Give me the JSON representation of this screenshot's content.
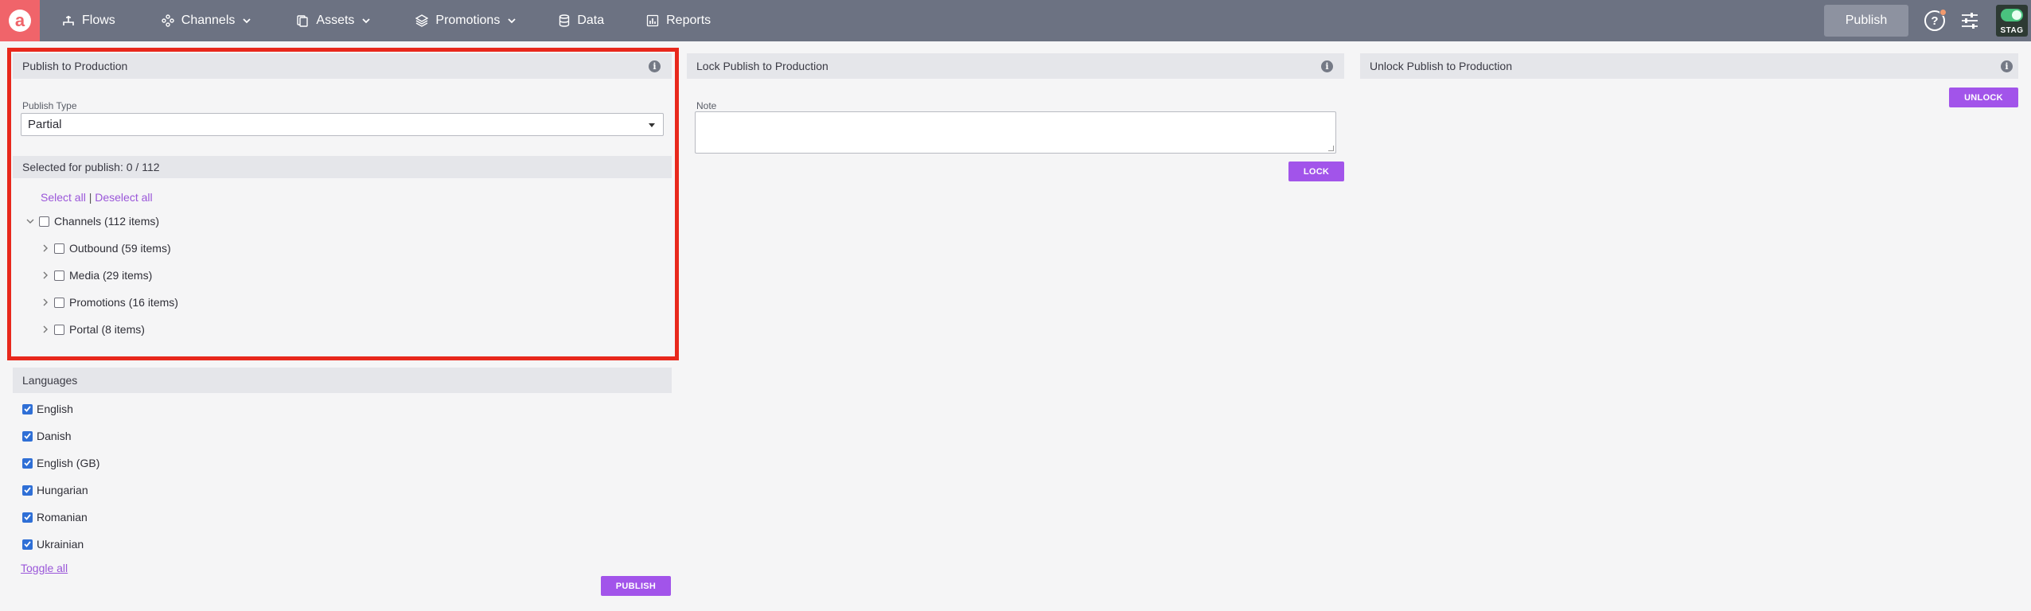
{
  "nav": {
    "flows": "Flows",
    "channels": "Channels",
    "assets": "Assets",
    "promotions": "Promotions",
    "data": "Data",
    "reports": "Reports",
    "publish_button": "Publish",
    "help_symbol": "?",
    "env_label": "STAG"
  },
  "publish_panel": {
    "title": "Publish to Production",
    "publish_type_label": "Publish Type",
    "publish_type_value": "Partial",
    "selected_summary": "Selected for publish: 0 / 112",
    "select_all": "Select all",
    "separator": "|",
    "deselect_all": "Deselect all",
    "tree": {
      "root": "Channels (112 items)",
      "children": [
        "Outbound (59 items)",
        "Media (29 items)",
        "Promotions (16 items)",
        "Portal (8 items)"
      ]
    }
  },
  "languages_panel": {
    "title": "Languages",
    "items": [
      "English",
      "Danish",
      "English (GB)",
      "Hungarian",
      "Romanian",
      "Ukrainian"
    ],
    "toggle_all": "Toggle all",
    "publish_button": "PUBLISH"
  },
  "lock_panel": {
    "title": "Lock Publish to Production",
    "note_label": "Note",
    "note_value": "",
    "lock_button": "LOCK"
  },
  "unlock_panel": {
    "title": "Unlock Publish to Production",
    "unlock_button": "UNLOCK"
  },
  "info_symbol": "i",
  "colors": {
    "topbar": "#6c7282",
    "logo": "#f0646a",
    "accent": "#a254ea",
    "link": "#9a56d9",
    "highlight": "#e8281c",
    "checkbox_checked": "#2f6fd6"
  },
  "icons": {
    "logo": "aktivo-logo",
    "flows": "flows-icon",
    "channels": "channels-icon",
    "assets": "assets-icon",
    "promotions": "promotions-icon",
    "data": "database-icon",
    "reports": "bar-chart-icon",
    "help": "help-icon",
    "settings": "sliders-icon",
    "info": "info-icon"
  }
}
